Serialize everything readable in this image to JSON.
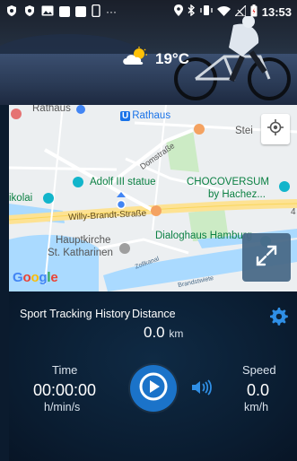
{
  "status_bar": {
    "time": "13:53",
    "left_icons": [
      "shield-icon",
      "shield-icon",
      "image-icon",
      "square-icon",
      "square-icon",
      "phone-icon",
      "more-icon"
    ],
    "right_icons": [
      "location-icon",
      "bluetooth-icon",
      "vibrate-icon",
      "wifi-icon",
      "no-signal-icon",
      "battery-icon"
    ]
  },
  "weather": {
    "temperature": "19°C",
    "icon": "partly-cloudy-icon"
  },
  "map": {
    "labels": {
      "rathaus_top": "Rathaus",
      "rathaus_metro": "Rathaus",
      "stein": "Stei",
      "domstrasse": "Domstraße",
      "adolf": "Adolf III statue",
      "chocoversum_1": "CHOCOVERSUM",
      "chocoversum_2": "by Hachez...",
      "nikolai": "ikolai",
      "willy": "Willy-Brandt-Straße",
      "four": "4",
      "hauptkirche_1": "Hauptkirche",
      "hauptkirche_2": "St. Katharinen",
      "dialoghaus": "Dialoghaus Hamburg",
      "zollkanal": "Zollkanal",
      "brandstwiete": "Brandstwiete",
      "google": "Google"
    },
    "metro_badge": "U"
  },
  "panel": {
    "history_label": "Sport Tracking History",
    "distance_label": "Distance",
    "distance_value": "0.0",
    "distance_unit": "km",
    "time_label": "Time",
    "time_value": "00:00:00",
    "time_unit": "h/min/s",
    "speed_label": "Speed",
    "speed_value": "0.0",
    "speed_unit": "km/h"
  },
  "colors": {
    "accent": "#1b73c9",
    "panel_bg": "#0a1c30",
    "icon_blue": "#2f8fe6"
  }
}
